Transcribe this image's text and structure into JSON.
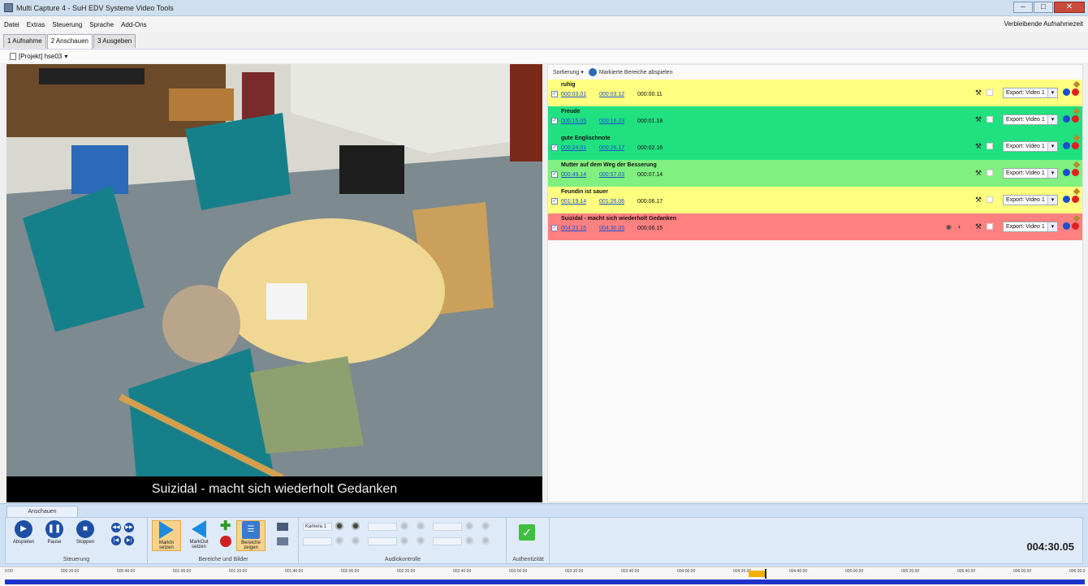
{
  "window": {
    "title": "Multi Capture 4 - SuH EDV Systeme Video Tools"
  },
  "menu": {
    "items": [
      "Datei",
      "Extras",
      "Steuerung",
      "Sprache",
      "Add-Ons"
    ],
    "right_label": "Verbleibende Aufnahmezeit"
  },
  "tabs": [
    "1 Aufnahme",
    "2 Anschauen",
    "3 Ausgeben"
  ],
  "project": {
    "label": "[Projekt] hse03"
  },
  "video": {
    "caption": "Suizidal - macht sich wiederholt Gedanken"
  },
  "list": {
    "sort_label": "Sortierung",
    "play_marked_label": "Markierte Bereiche abspielen",
    "export_default": "Export: Video 1",
    "markers": [
      {
        "title": "ruhig",
        "in": "000:03.01",
        "out": "000:03.12",
        "dur": "000:00.11",
        "color": "#ffff80"
      },
      {
        "title": "Freude",
        "in": "000:15.05",
        "out": "000:16.23",
        "dur": "000:01.18",
        "color": "#20e080"
      },
      {
        "title": "gute Englischnote",
        "in": "000:24.01",
        "out": "000:26.17",
        "dur": "000:02.16",
        "color": "#20e080"
      },
      {
        "title": "Mutter auf dem Weg der Besserung",
        "in": "000:49.14",
        "out": "000:57.03",
        "dur": "000:07.14",
        "color": "#80f080"
      },
      {
        "title": "Feundin ist sauer",
        "in": "001:19.14",
        "out": "001:26.06",
        "dur": "000:06.17",
        "color": "#ffff80"
      },
      {
        "title": "Suizidal - macht sich wiederholt Gedanken",
        "in": "004:23.15",
        "out": "004:30.05",
        "dur": "000:06.15",
        "color": "#ff8080"
      }
    ]
  },
  "ribbon": {
    "tab_label": "Anschauen",
    "steuerung": {
      "label": "Steuerung",
      "play": "Abspielen",
      "pause": "Pause",
      "stop": "Stoppen"
    },
    "bereiche": {
      "label": "Bereiche und Bilder",
      "markin": "MarkIn setzen",
      "markout": "MarkOut setzen",
      "zeigen": "Bereiche zeigen"
    },
    "audio": {
      "label": "Audiokontrolle",
      "cam1": "Kamera 1"
    },
    "auth": {
      "label": "Authentizität"
    },
    "timer": "004:30.05"
  },
  "timeline": {
    "ticks": [
      "0:00",
      "000:20.00",
      "000:40.00",
      "001:00.00",
      "001:20.00",
      "001:40.00",
      "002:00.00",
      "002:20.00",
      "002:40.00",
      "003:00.00",
      "003:20.00",
      "003:40.00",
      "004:00.00",
      "004:20.00",
      "004:40.00",
      "005:00.00",
      "005:20.00",
      "005:40.00",
      "006:00.00",
      "006:20.0"
    ]
  }
}
